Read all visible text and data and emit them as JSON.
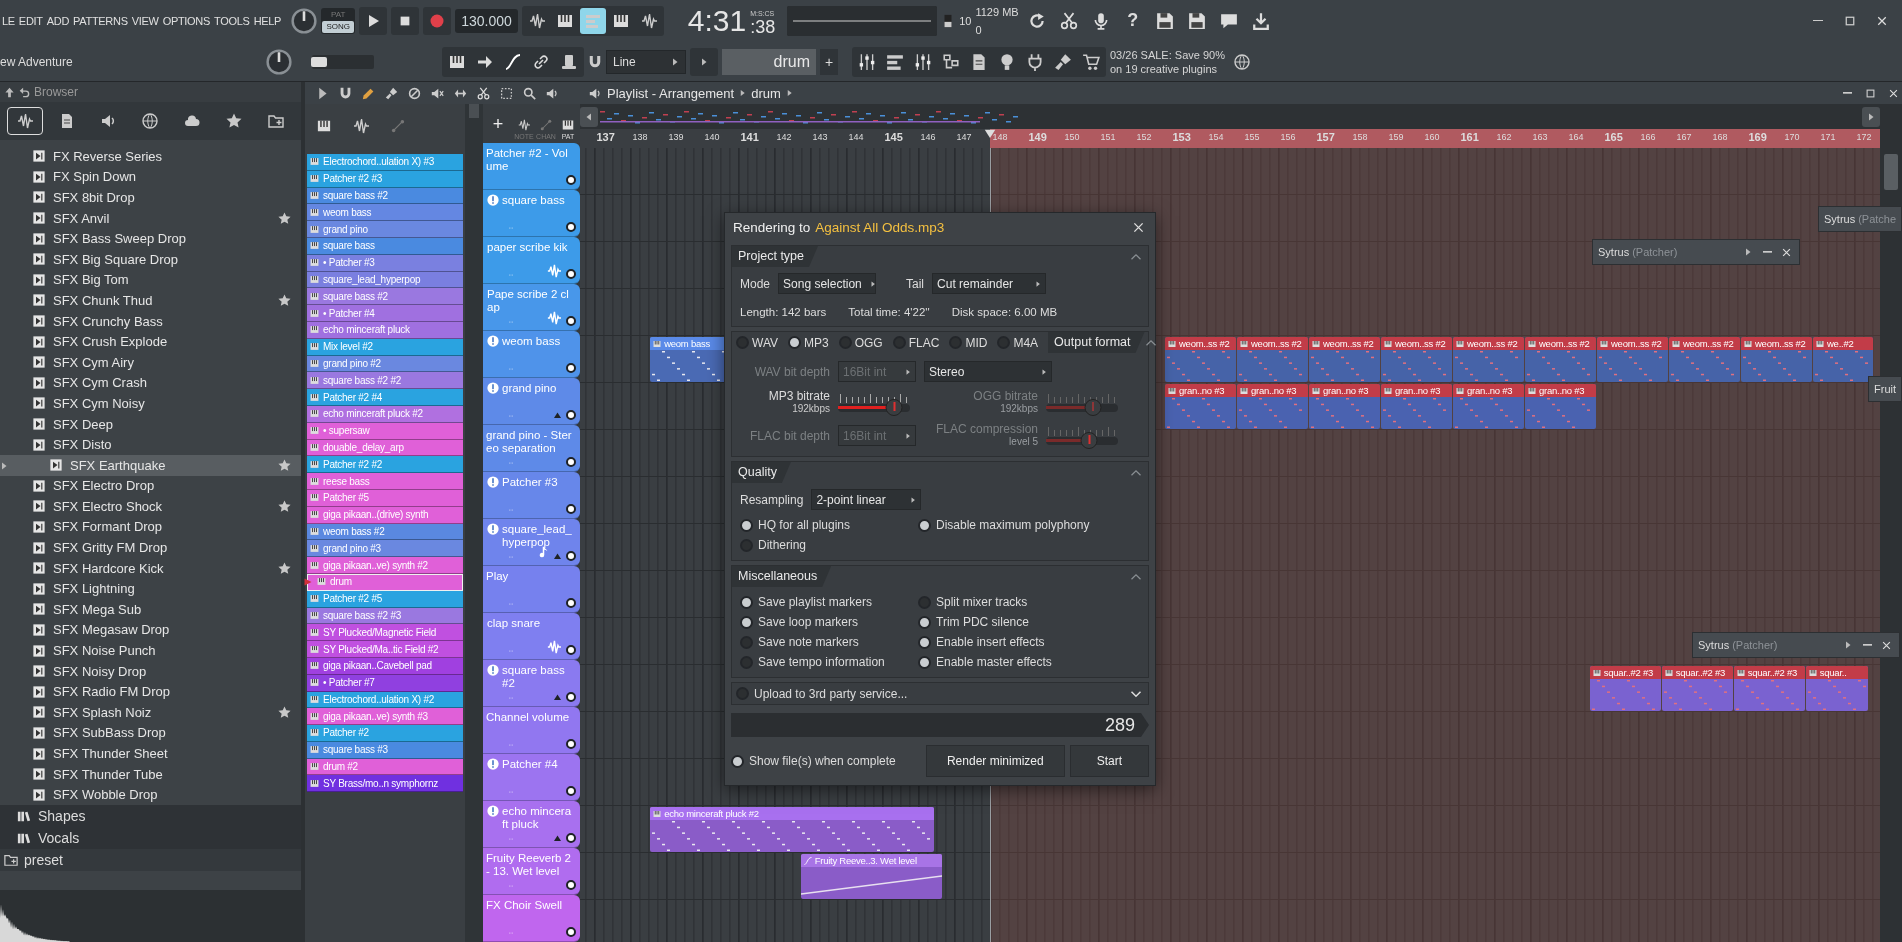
{
  "menu": [
    "LE",
    "EDIT",
    "ADD",
    "PATTERNS",
    "VIEW",
    "OPTIONS",
    "TOOLS",
    "HELP"
  ],
  "transport": {
    "modes": [
      {
        "label": "PAT",
        "selected": false
      },
      {
        "label": "SONG",
        "selected": true
      }
    ],
    "tempo": "130.000",
    "toggles": [
      {
        "on": false
      },
      {
        "on": false
      },
      {
        "on": true
      },
      {
        "on": false
      },
      {
        "on": false
      }
    ],
    "time": "4:31",
    "time_label": "M:S:CS",
    "time_cs": ":38",
    "cpu": "10",
    "memory": "1129 MB",
    "polyphony": "0",
    "help": "?"
  },
  "project": {
    "title": "ew Adventure",
    "pitch": {
      "level": 0.12
    }
  },
  "toolbar2": {
    "snap": "Line",
    "pattern": "drum",
    "add": "+",
    "hint": "03/26 SALE: Save 90% on 19 creative plugins"
  },
  "browser": {
    "title": "Browser",
    "tabs": [
      {
        "selected": true
      },
      {
        "selected": false
      },
      {
        "selected": false
      },
      {
        "selected": false
      },
      {
        "selected": false
      },
      {
        "selected": false
      },
      {
        "selected": false
      }
    ],
    "files": [
      {
        "name": "FX Reverse Series",
        "starred": false,
        "selected": false
      },
      {
        "name": "FX Spin Down",
        "starred": false,
        "selected": false
      },
      {
        "name": "SFX 8bit Drop",
        "starred": false,
        "selected": false
      },
      {
        "name": "SFX Anvil",
        "starred": true,
        "selected": false
      },
      {
        "name": "SFX Bass Sweep Drop",
        "starred": false,
        "selected": false
      },
      {
        "name": "SFX Big Square Drop",
        "starred": false,
        "selected": false
      },
      {
        "name": "SFX Big Tom",
        "starred": false,
        "selected": false
      },
      {
        "name": "SFX Chunk Thud",
        "starred": true,
        "selected": false
      },
      {
        "name": "SFX Crunchy Bass",
        "starred": false,
        "selected": false
      },
      {
        "name": "SFX Crush Explode",
        "starred": false,
        "selected": false
      },
      {
        "name": "SFX Cym Airy",
        "starred": false,
        "selected": false
      },
      {
        "name": "SFX Cym Crash",
        "starred": false,
        "selected": false
      },
      {
        "name": "SFX Cym Noisy",
        "starred": false,
        "selected": false
      },
      {
        "name": "SFX Deep",
        "starred": false,
        "selected": false
      },
      {
        "name": "SFX Disto",
        "starred": false,
        "selected": false
      },
      {
        "name": "SFX Earthquake",
        "starred": true,
        "selected": true
      },
      {
        "name": "SFX Electro Drop",
        "starred": false,
        "selected": false
      },
      {
        "name": "SFX Electro Shock",
        "starred": true,
        "selected": false
      },
      {
        "name": "SFX Formant Drop",
        "starred": false,
        "selected": false
      },
      {
        "name": "SFX Gritty FM Drop",
        "starred": false,
        "selected": false
      },
      {
        "name": "SFX Hardcore Kick",
        "starred": true,
        "selected": false
      },
      {
        "name": "SFX Lightning",
        "starred": false,
        "selected": false
      },
      {
        "name": "SFX Mega Sub",
        "starred": false,
        "selected": false
      },
      {
        "name": "SFX Megasaw Drop",
        "starred": false,
        "selected": false
      },
      {
        "name": "SFX Noise Punch",
        "starred": false,
        "selected": false
      },
      {
        "name": "SFX Noisy Drop",
        "starred": false,
        "selected": false
      },
      {
        "name": "SFX Radio FM Drop",
        "starred": false,
        "selected": false
      },
      {
        "name": "SFX Splash Noiz",
        "starred": true,
        "selected": false
      },
      {
        "name": "SFX SubBass Drop",
        "starred": false,
        "selected": false
      },
      {
        "name": "SFX Thunder Sheet",
        "starred": false,
        "selected": false
      },
      {
        "name": "SFX Thunder Tube",
        "starred": false,
        "selected": false
      },
      {
        "name": "SFX Wobble Drop",
        "starred": false,
        "selected": false
      }
    ],
    "sibling_folders": [
      {
        "name": "Shapes"
      },
      {
        "name": "Vocals"
      }
    ],
    "top_folders": [
      {
        "name": "preset"
      }
    ]
  },
  "patterns": [
    {
      "name": "Electrochord..ulation X) #3",
      "color": "#2aa3e0",
      "selected": false
    },
    {
      "name": "Patcher #2 #3",
      "color": "#2aa3e0",
      "selected": false
    },
    {
      "name": "square bass #2",
      "color": "#4a8ae0",
      "selected": false
    },
    {
      "name": "weom bass",
      "color": "#6487e2",
      "selected": false
    },
    {
      "name": "grand pino",
      "color": "#6a88e0",
      "selected": false
    },
    {
      "name": "square bass",
      "color": "#4a8ae0",
      "selected": false
    },
    {
      "name": "• Patcher #3",
      "color": "#7a80e0",
      "selected": false
    },
    {
      "name": "square_lead_hyperpop",
      "color": "#7a7fe0",
      "selected": false
    },
    {
      "name": "square bass #2",
      "color": "#9a78e0",
      "selected": false
    },
    {
      "name": "• Patcher #4",
      "color": "#a070e0",
      "selected": false
    },
    {
      "name": "echo minceraft pluck",
      "color": "#a070e0",
      "selected": false
    },
    {
      "name": "Mix level #2",
      "color": "#2aa3e0",
      "selected": false
    },
    {
      "name": "grand pino #2",
      "color": "#6a88e0",
      "selected": false
    },
    {
      "name": "square bass #2 #2",
      "color": "#9a78e0",
      "selected": false
    },
    {
      "name": "Patcher #2 #4",
      "color": "#2aa3e0",
      "selected": false
    },
    {
      "name": "echo minceraft pluck #2",
      "color": "#b070e0",
      "selected": false
    },
    {
      "name": "• supersaw",
      "color": "#e060d8",
      "selected": false
    },
    {
      "name": "douable_delay_arp",
      "color": "#e060d8",
      "selected": false
    },
    {
      "name": "Patcher #2 #2",
      "color": "#2aa3e0",
      "selected": false
    },
    {
      "name": "reese bass",
      "color": "#e060d8",
      "selected": false
    },
    {
      "name": "Patcher #5",
      "color": "#e060d8",
      "selected": false
    },
    {
      "name": "giga pikaan..(drive) synth",
      "color": "#e060d8",
      "selected": false
    },
    {
      "name": "weom bass #2",
      "color": "#5a88e0",
      "selected": false
    },
    {
      "name": "grand pino #3",
      "color": "#6a88e0",
      "selected": false
    },
    {
      "name": "giga pikaan..ve) synth #2",
      "color": "#e060d8",
      "selected": false
    },
    {
      "name": "drum",
      "color": "#e060d8",
      "selected": true
    },
    {
      "name": "Patcher #2 #5",
      "color": "#2aa3e0",
      "selected": false
    },
    {
      "name": "square bass #2 #3",
      "color": "#9a78e0",
      "selected": false
    },
    {
      "name": "SY Plucked/Magnetic Field",
      "color": "#c050e0",
      "selected": false
    },
    {
      "name": "SY Plucked/Ma..tic Field #2",
      "color": "#c050e0",
      "selected": false
    },
    {
      "name": "giga pikaan..Cavebell pad",
      "color": "#a040e0",
      "selected": false
    },
    {
      "name": "• Patcher #7",
      "color": "#9040e0",
      "selected": false
    },
    {
      "name": "Electrochord..ulation X) #2",
      "color": "#2aa3e0",
      "selected": false
    },
    {
      "name": "giga pikaan..ve) synth #3",
      "color": "#e060d8",
      "selected": false
    },
    {
      "name": "Patcher #2",
      "color": "#2aa3e0",
      "selected": false
    },
    {
      "name": "square bass #3",
      "color": "#4a8ae0",
      "selected": false
    },
    {
      "name": "drum #2",
      "color": "#e060d8",
      "selected": false
    },
    {
      "name": "SY Brass/mo..n symphornz",
      "color": "#7030e0",
      "selected": false
    }
  ],
  "playlist": {
    "title": "Playlist - Arrangement",
    "pattern": "drum",
    "add_track": "+",
    "track_modes": [
      {
        "label": "NOTE",
        "selected": false
      },
      {
        "label": "CHAN",
        "selected": false
      },
      {
        "label": "PAT",
        "selected": true
      }
    ],
    "bars": [
      "137",
      "138",
      "139",
      "140",
      "141",
      "142",
      "143",
      "144",
      "145",
      "146",
      "147",
      "148",
      "149",
      "150",
      "151",
      "152",
      "153",
      "154",
      "155",
      "156",
      "157",
      "158",
      "159",
      "160",
      "161",
      "162",
      "163",
      "164",
      "165",
      "166",
      "167",
      "168",
      "169",
      "170",
      "171",
      "172"
    ],
    "tracks": [
      {
        "name": "Patcher #2 - Volume",
        "kind": "automation",
        "color": "#3d9be9",
        "enabled": true
      },
      {
        "name": "square bass",
        "kind": "instrument",
        "color": "#3d9be9",
        "enabled": true
      },
      {
        "name": "paper scribe kik",
        "kind": "audio",
        "color": "#3d9be9",
        "enabled": true
      },
      {
        "name": "Pape scribe 2 clap",
        "kind": "audio",
        "color": "#4897ea",
        "enabled": true
      },
      {
        "name": "weom bass",
        "kind": "instrument",
        "color": "#4f93ea",
        "enabled": true,
        "clips": [
          {
            "label": "weom bass",
            "selected": false,
            "color": "#4a6ab4"
          },
          {
            "label": "weom..ss #2",
            "selected": true,
            "color": "#4663a8"
          },
          {
            "label": "weom..ss #2",
            "selected": true,
            "color": "#4663a8"
          },
          {
            "label": "weom..ss #2",
            "selected": true,
            "color": "#4663a8"
          },
          {
            "label": "weom..ss #2",
            "selected": true,
            "color": "#4663a8"
          },
          {
            "label": "weom..ss #2",
            "selected": true,
            "color": "#4663a8"
          },
          {
            "label": "weom..ss #2",
            "selected": true,
            "color": "#4663a8"
          },
          {
            "label": "weom..ss #2",
            "selected": true,
            "color": "#4663a8"
          },
          {
            "label": "weom..ss #2",
            "selected": true,
            "color": "#4663a8"
          },
          {
            "label": "weom..ss #2",
            "selected": true,
            "color": "#4663a8"
          },
          {
            "label": "we..#2",
            "selected": true,
            "color": "#4663a8"
          }
        ]
      },
      {
        "name": "grand pino",
        "kind": "instrument-open",
        "color": "#5e8ae8",
        "enabled": true,
        "clips": [
          {
            "label": "gran..no #3",
            "selected": true,
            "color": "#4a62b0"
          },
          {
            "label": "gran..no #3",
            "selected": true,
            "color": "#4a62b0"
          },
          {
            "label": "gran..no #3",
            "selected": true,
            "color": "#4a62b0"
          },
          {
            "label": "gran..no #3",
            "selected": true,
            "color": "#4a62b0"
          },
          {
            "label": "gran..no #3",
            "selected": true,
            "color": "#4a62b0"
          },
          {
            "label": "gran..no #3",
            "selected": true,
            "color": "#4a62b0"
          }
        ]
      },
      {
        "name": "grand pino - Stereo separation",
        "kind": "automation",
        "color": "#5e8ae8",
        "enabled": true
      },
      {
        "name": "Patcher #3",
        "kind": "instrument",
        "color": "#6787ea",
        "enabled": true
      },
      {
        "name": "square_lead_hyperpop",
        "kind": "instrument-note",
        "color": "#6f84ec",
        "enabled": true
      },
      {
        "name": "Play",
        "kind": "automation",
        "color": "#7681ee",
        "enabled": true
      },
      {
        "name": "clap snare",
        "kind": "audio",
        "color": "#7f7ff0",
        "enabled": true
      },
      {
        "name": "square bass #2",
        "kind": "instrument-open",
        "color": "#8a7af0",
        "enabled": true,
        "clips": [
          {
            "label": "squar..#2 #3",
            "selected": true,
            "color": "#7a62d0"
          },
          {
            "label": "squar..#2 #3",
            "selected": true,
            "color": "#7a62d0"
          },
          {
            "label": "squar..#2 #3",
            "selected": true,
            "color": "#7a62d0"
          },
          {
            "label": "squar..",
            "selected": true,
            "color": "#7a62d0"
          }
        ]
      },
      {
        "name": "Channel volume",
        "kind": "automation",
        "color": "#9177f0",
        "enabled": true
      },
      {
        "name": "Patcher #4",
        "kind": "instrument",
        "color": "#9c74f0",
        "enabled": true
      },
      {
        "name": "echo minceraft pluck",
        "kind": "instrument-open",
        "color": "#a870ef",
        "enabled": true,
        "clips": [
          {
            "label": "echo minceraft pluck #2",
            "selected": false,
            "color": "#8a5cc8"
          }
        ]
      },
      {
        "name": "Fruity Reeverb 2 - 13. Wet level",
        "kind": "automation",
        "color": "#b06cef",
        "enabled": true,
        "clips": [
          {
            "label": "Fruity Reeve..3. Wet level",
            "selected": false,
            "color": "#8a5cc8",
            "kind": "automation"
          }
        ]
      },
      {
        "name": "FX Choir Swell",
        "kind": "automation",
        "color": "#c066ee",
        "enabled": true
      }
    ]
  },
  "windows": [
    {
      "title": "Sytrus",
      "subtitle": "(Patcher)",
      "controls": true
    },
    {
      "title": "Sytrus",
      "subtitle": "(Patcher)",
      "controls": true
    },
    {
      "title": "Sytrus",
      "subtitle": "(Patche"
    },
    {
      "title": "Fruit"
    }
  ],
  "dialog": {
    "title": "Rendering to",
    "file": "Against All Odds.mp3",
    "project_type": {
      "title": "Project type",
      "mode_label": "Mode",
      "mode": "Song selection",
      "tail_label": "Tail",
      "tail": "Cut remainder",
      "stats": [
        "Length: 142 bars",
        "Total time: 4'22''",
        "Disk space: 6.00 MB"
      ]
    },
    "output": {
      "title": "Output format",
      "formats": [
        {
          "label": "WAV",
          "selected": false
        },
        {
          "label": "MP3",
          "selected": true
        },
        {
          "label": "OGG",
          "selected": false
        },
        {
          "label": "FLAC",
          "selected": false
        },
        {
          "label": "MID",
          "selected": false
        },
        {
          "label": "M4A",
          "selected": false
        }
      ],
      "settings": [
        {
          "kind": "dropdown",
          "label": "WAV bit depth",
          "value": "16Bit int",
          "disabled": true
        },
        {
          "kind": "dropdown",
          "value": "Stereo",
          "disabled": false
        },
        {
          "kind": "slider",
          "label": "MP3 bitrate",
          "reading": "192kbps",
          "level": 0.78,
          "disabled": false
        },
        {
          "kind": "slider",
          "label": "OGG bitrate",
          "reading": "192kbps",
          "level": 0.65,
          "disabled": true
        },
        {
          "kind": "dropdown",
          "label": "FLAC bit depth",
          "value": "16Bit int",
          "disabled": true
        },
        {
          "kind": "slider",
          "label": "FLAC compression",
          "reading": "level 5",
          "level": 0.6,
          "disabled": true
        }
      ]
    },
    "quality": {
      "title": "Quality",
      "resampling_label": "Resampling",
      "resampling": "2-point linear",
      "options": [
        {
          "label": "HQ for all plugins",
          "checked": true
        },
        {
          "label": "Disable maximum polyphony",
          "checked": true
        },
        {
          "label": "Dithering",
          "checked": false
        }
      ]
    },
    "misc": {
      "title": "Miscellaneous",
      "options": [
        {
          "label": "Save playlist markers",
          "checked": true
        },
        {
          "label": "Split mixer tracks",
          "checked": false
        },
        {
          "label": "Save loop markers",
          "checked": true
        },
        {
          "label": "Trim PDC silence",
          "checked": true
        },
        {
          "label": "Save note markers",
          "checked": false
        },
        {
          "label": "Enable insert effects",
          "checked": true
        },
        {
          "label": "Save tempo information",
          "checked": false
        },
        {
          "label": "Enable master effects",
          "checked": true
        }
      ]
    },
    "upload": {
      "label": "Upload to 3rd party service...",
      "checked": false
    },
    "progress": {
      "reading": "289"
    },
    "show_files": {
      "label": "Show file(s) when complete",
      "checked": true
    },
    "buttons": [
      "Render minimized",
      "Start"
    ]
  }
}
